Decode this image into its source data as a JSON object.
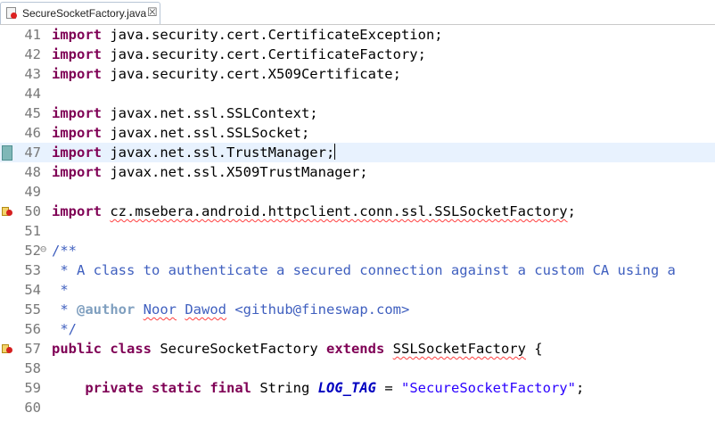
{
  "tab": {
    "title": "SecureSocketFactory.java",
    "close": "☒"
  },
  "lines": [
    {
      "num": "41",
      "parts": [
        {
          "t": "import",
          "c": "kw"
        },
        {
          "t": " java.security.cert.CertificateException;"
        }
      ]
    },
    {
      "num": "42",
      "parts": [
        {
          "t": "import",
          "c": "kw"
        },
        {
          "t": " java.security.cert.CertificateFactory;"
        }
      ]
    },
    {
      "num": "43",
      "parts": [
        {
          "t": "import",
          "c": "kw"
        },
        {
          "t": " java.security.cert.X509Certificate;"
        }
      ]
    },
    {
      "num": "44",
      "parts": []
    },
    {
      "num": "45",
      "parts": [
        {
          "t": "import",
          "c": "kw"
        },
        {
          "t": " javax.net.ssl.SSLContext;"
        }
      ]
    },
    {
      "num": "46",
      "parts": [
        {
          "t": "import",
          "c": "kw"
        },
        {
          "t": " javax.net.ssl.SSLSocket;"
        }
      ]
    },
    {
      "num": "47",
      "current": true,
      "marker": "change",
      "parts": [
        {
          "t": "import",
          "c": "kw"
        },
        {
          "t": " javax.net.ssl.TrustManager;"
        },
        {
          "caret": true
        }
      ]
    },
    {
      "num": "48",
      "parts": [
        {
          "t": "import",
          "c": "kw"
        },
        {
          "t": " javax.net.ssl.X509TrustManager;"
        }
      ]
    },
    {
      "num": "49",
      "parts": []
    },
    {
      "num": "50",
      "marker": "warn",
      "parts": [
        {
          "t": "import",
          "c": "kw"
        },
        {
          "t": " "
        },
        {
          "t": "cz.msebera.android.httpclient.conn.ssl.SSLSocketFactory",
          "c": "squig"
        },
        {
          "t": ";"
        }
      ]
    },
    {
      "num": "51",
      "parts": []
    },
    {
      "num": "52",
      "fold": "⊖",
      "parts": [
        {
          "t": "/**",
          "c": "jd"
        }
      ]
    },
    {
      "num": "53",
      "parts": [
        {
          "t": " * A class to authenticate a secured connection against a custom CA using a",
          "c": "jd"
        }
      ]
    },
    {
      "num": "54",
      "parts": [
        {
          "t": " *",
          "c": "jd"
        }
      ]
    },
    {
      "num": "55",
      "parts": [
        {
          "t": " * ",
          "c": "jd"
        },
        {
          "t": "@author",
          "c": "jdtag"
        },
        {
          "t": " ",
          "c": "jd"
        },
        {
          "t": "Noor",
          "c": "jd squig"
        },
        {
          "t": " ",
          "c": "jd"
        },
        {
          "t": "Dawod",
          "c": "jd squig"
        },
        {
          "t": " <github@fineswap.com>",
          "c": "jd"
        }
      ]
    },
    {
      "num": "56",
      "parts": [
        {
          "t": " */",
          "c": "jd"
        }
      ]
    },
    {
      "num": "57",
      "marker": "warn",
      "parts": [
        {
          "t": "public",
          "c": "kw"
        },
        {
          "t": " "
        },
        {
          "t": "class",
          "c": "kw"
        },
        {
          "t": " SecureSocketFactory "
        },
        {
          "t": "extends",
          "c": "kw"
        },
        {
          "t": " "
        },
        {
          "t": "SSLSocketFactory",
          "c": "squig"
        },
        {
          "t": " {"
        }
      ]
    },
    {
      "num": "58",
      "parts": []
    },
    {
      "num": "59",
      "parts": [
        {
          "t": "    "
        },
        {
          "t": "private",
          "c": "kw"
        },
        {
          "t": " "
        },
        {
          "t": "static",
          "c": "kw"
        },
        {
          "t": " "
        },
        {
          "t": "final",
          "c": "kw"
        },
        {
          "t": " String "
        },
        {
          "t": "LOG_TAG",
          "c": "const"
        },
        {
          "t": " = "
        },
        {
          "t": "\"SecureSocketFactory\"",
          "c": "str"
        },
        {
          "t": ";"
        }
      ]
    },
    {
      "num": "60",
      "parts": []
    }
  ]
}
